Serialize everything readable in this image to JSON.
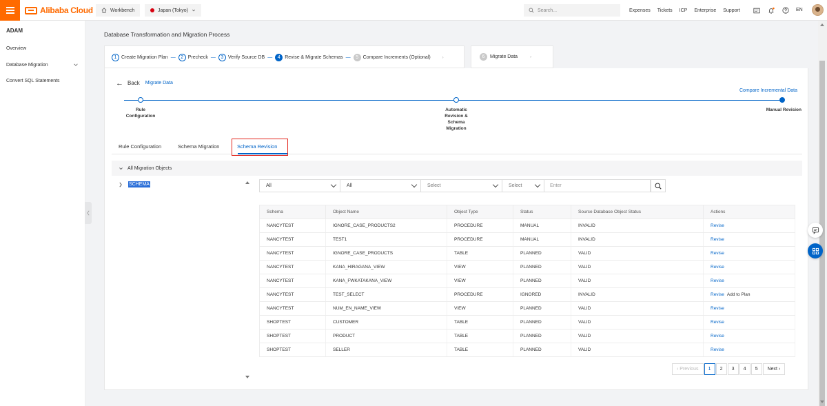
{
  "colors": {
    "brand": "#ff6a00",
    "primary": "#0064c8",
    "highlight": "#e2231a"
  },
  "topbar": {
    "brand": "Alibaba Cloud",
    "workbench": "Workbench",
    "region": "Japan (Tokyo)",
    "search_placeholder": "Search...",
    "links": [
      "Expenses",
      "Tickets",
      "ICP",
      "Enterprise",
      "Support"
    ],
    "lang": "EN"
  },
  "sidebar": {
    "title": "ADAM",
    "items": [
      {
        "label": "Overview"
      },
      {
        "label": "Database Migration"
      },
      {
        "label": "Convert SQL Statements"
      }
    ]
  },
  "main": {
    "heading": "Database Transformation and Migration Process",
    "steps": [
      {
        "num": "1",
        "label": "Create Migration Plan"
      },
      {
        "num": "2",
        "label": "Precheck"
      },
      {
        "num": "3",
        "label": "Verify Source DB"
      },
      {
        "num": "4",
        "label": "Revise & Migrate Schemas"
      },
      {
        "num": "5",
        "label": "Compare Increments (Optional)"
      }
    ],
    "next_step": {
      "num": "6",
      "label": "Migrate Data"
    },
    "back_label": "Back",
    "back_link": "Migrate Data",
    "compare_link": "Compare Incremental Data",
    "progress": [
      {
        "label_lines": [
          "Rule",
          "Configuration"
        ]
      },
      {
        "label_lines": [
          "Automatic",
          "Revision &",
          "Schema",
          "Migration"
        ]
      },
      {
        "label_lines": [
          "Manual Revision"
        ]
      }
    ],
    "tabs": [
      "Rule Configuration",
      "Schema Migration",
      "Schema Revision"
    ],
    "all_objects": "All Migration Objects",
    "tree_node": "SCHEMA",
    "filters": {
      "f1": "All",
      "f2": "All",
      "f3": "Select",
      "f4": "Select",
      "input_placeholder": "Enter"
    },
    "table": {
      "headers": [
        "Schema",
        "Object Name",
        "Object Type",
        "Status",
        "Source Database Object Status",
        "Actions"
      ],
      "rows": [
        [
          "NANCYTEST",
          "IGNORE_CASE_PRODUCTS2",
          "PROCEDURE",
          "MANUAL",
          "INVALID",
          "Revise",
          ""
        ],
        [
          "NANCYTEST",
          "TEST1",
          "PROCEDURE",
          "MANUAL",
          "INVALID",
          "Revise",
          ""
        ],
        [
          "NANCYTEST",
          "IGNORE_CASE_PRODUCTS",
          "TABLE",
          "PLANNED",
          "VALID",
          "Revise",
          ""
        ],
        [
          "NANCYTEST",
          "KANA_HIRAGANA_VIEW",
          "VIEW",
          "PLANNED",
          "VALID",
          "Revise",
          ""
        ],
        [
          "NANCYTEST",
          "KANA_FWKATAKANA_VIEW",
          "VIEW",
          "PLANNED",
          "VALID",
          "Revise",
          ""
        ],
        [
          "NANCYTEST",
          "TEST_SELECT",
          "PROCEDURE",
          "IGNORED",
          "INVALID",
          "Revise",
          "Add to Plan"
        ],
        [
          "NANCYTEST",
          "NUM_EN_NAME_VIEW",
          "VIEW",
          "PLANNED",
          "VALID",
          "Revise",
          ""
        ],
        [
          "SHOPTEST",
          "CUSTOMER",
          "TABLE",
          "PLANNED",
          "VALID",
          "Revise",
          ""
        ],
        [
          "SHOPTEST",
          "PRODUCT",
          "TABLE",
          "PLANNED",
          "VALID",
          "Revise",
          ""
        ],
        [
          "SHOPTEST",
          "SELLER",
          "TABLE",
          "PLANNED",
          "VALID",
          "Revise",
          ""
        ]
      ]
    },
    "pagination": {
      "prev": "Previous",
      "pages": [
        "1",
        "2",
        "3",
        "4",
        "5"
      ],
      "active": "1",
      "next": "Next"
    }
  }
}
